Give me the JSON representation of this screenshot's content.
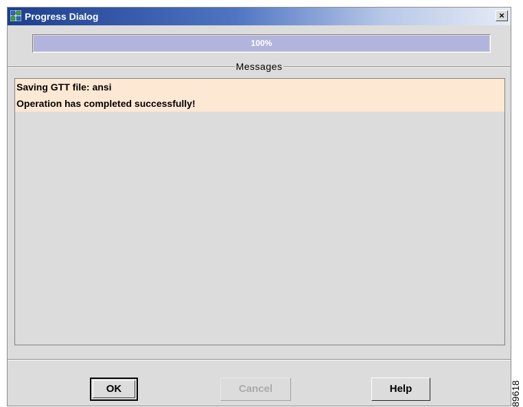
{
  "window": {
    "title": "Progress Dialog",
    "icon": "app-window-icon",
    "close_label": "×"
  },
  "progress": {
    "text": "100%",
    "value": 1.0
  },
  "messages": {
    "title": "Messages",
    "items": [
      "Saving GTT file: ansi",
      "Operation has completed successfully!"
    ]
  },
  "buttons": {
    "ok": "OK",
    "cancel": "Cancel",
    "help": "Help"
  },
  "figure_label": "89618",
  "colors": {
    "progress_fill": "#b3b4dd",
    "message_highlight": "#fde8d4",
    "title_bar": "#1c3e8e"
  }
}
